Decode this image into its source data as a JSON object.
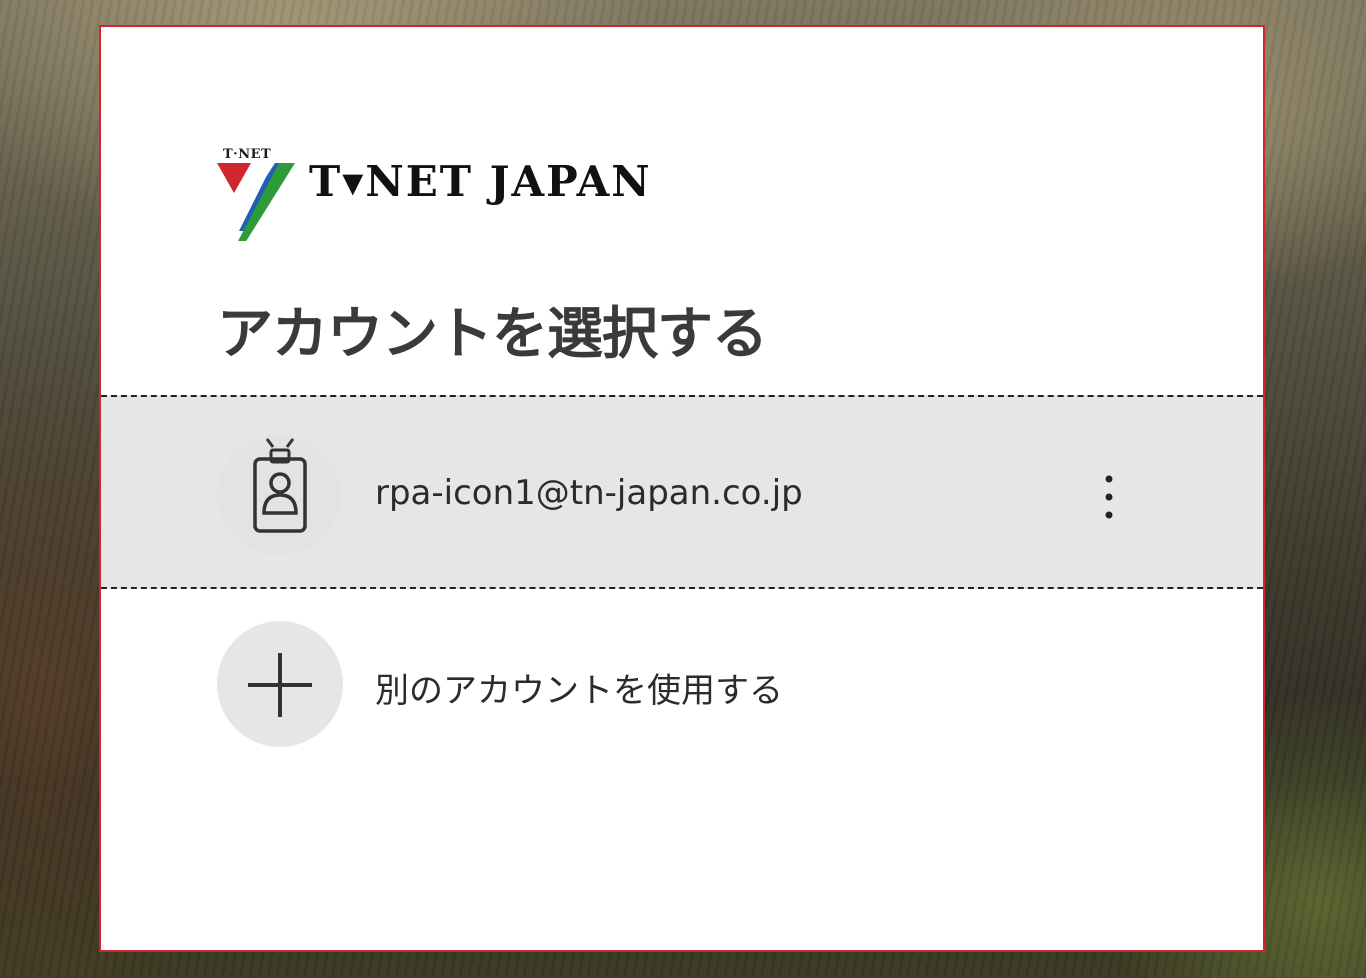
{
  "brand": {
    "logo_small_text": "T·NET",
    "logo_text": "T▾NET JAPAN",
    "colors": {
      "red": "#d0262d",
      "green": "#2e9b3a",
      "blue": "#1f5fb4"
    }
  },
  "header": {
    "title": "アカウントを選択する"
  },
  "accounts": [
    {
      "email": "rpa-icon1@tn-japan.co.jp",
      "icon": "badge-person-icon",
      "more_icon": "vertical-ellipsis-icon"
    }
  ],
  "add_account": {
    "label": "別のアカウントを使用する",
    "icon": "plus-icon"
  },
  "theme": {
    "card_border": "#d0262d",
    "selected_row_bg": "#e6e6e6",
    "title_color": "#3a3a3a"
  }
}
